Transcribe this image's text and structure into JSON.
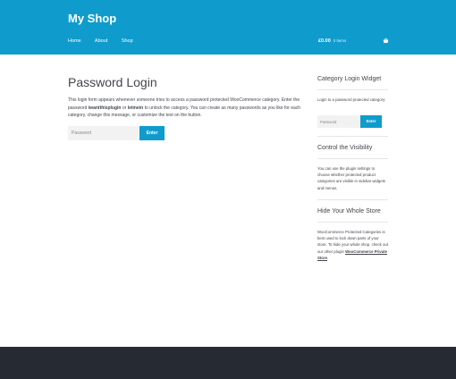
{
  "header": {
    "site_title": "My Shop",
    "nav": [
      "Home",
      "About",
      "Shop"
    ],
    "cart_amount": "£0.00",
    "cart_items": "0 items",
    "cart_icon": "basket-icon"
  },
  "main": {
    "title": "Password Login",
    "desc_1": "This login form appears whenever someone tries to access a password protected WooCommerce category. Enter the password ",
    "desc_pw1": "iwantthisplugin",
    "desc_2": " or ",
    "desc_pw2": "letmein",
    "desc_3": " to unlock the category. You can create as many passwords as you like for each category, change this message, or customize the text on the button.",
    "password_placeholder": "Password",
    "enter_label": "Enter"
  },
  "sidebar": {
    "widget1_title": "Category Login Widget",
    "widget1_text": "Login to a password protected category:",
    "widget1_placeholder": "Password",
    "widget1_button": "Enter",
    "widget2_title": "Control the Visibility",
    "widget2_text": "You can use the plugin settings to choose whether protected product categories are visible in sidebar widgets and menus.",
    "widget3_title": "Hide Your Whole Store",
    "widget3_text": "WooCommerce Protected Categories is best used to lock down parts of your store. To hide your whole shop, check out our other plugin ",
    "widget3_link": "WooCommerce Private Store",
    "widget3_end": "."
  },
  "colors": {
    "accent": "#0f9ccd",
    "footer": "#262a33",
    "text": "#43454b"
  }
}
